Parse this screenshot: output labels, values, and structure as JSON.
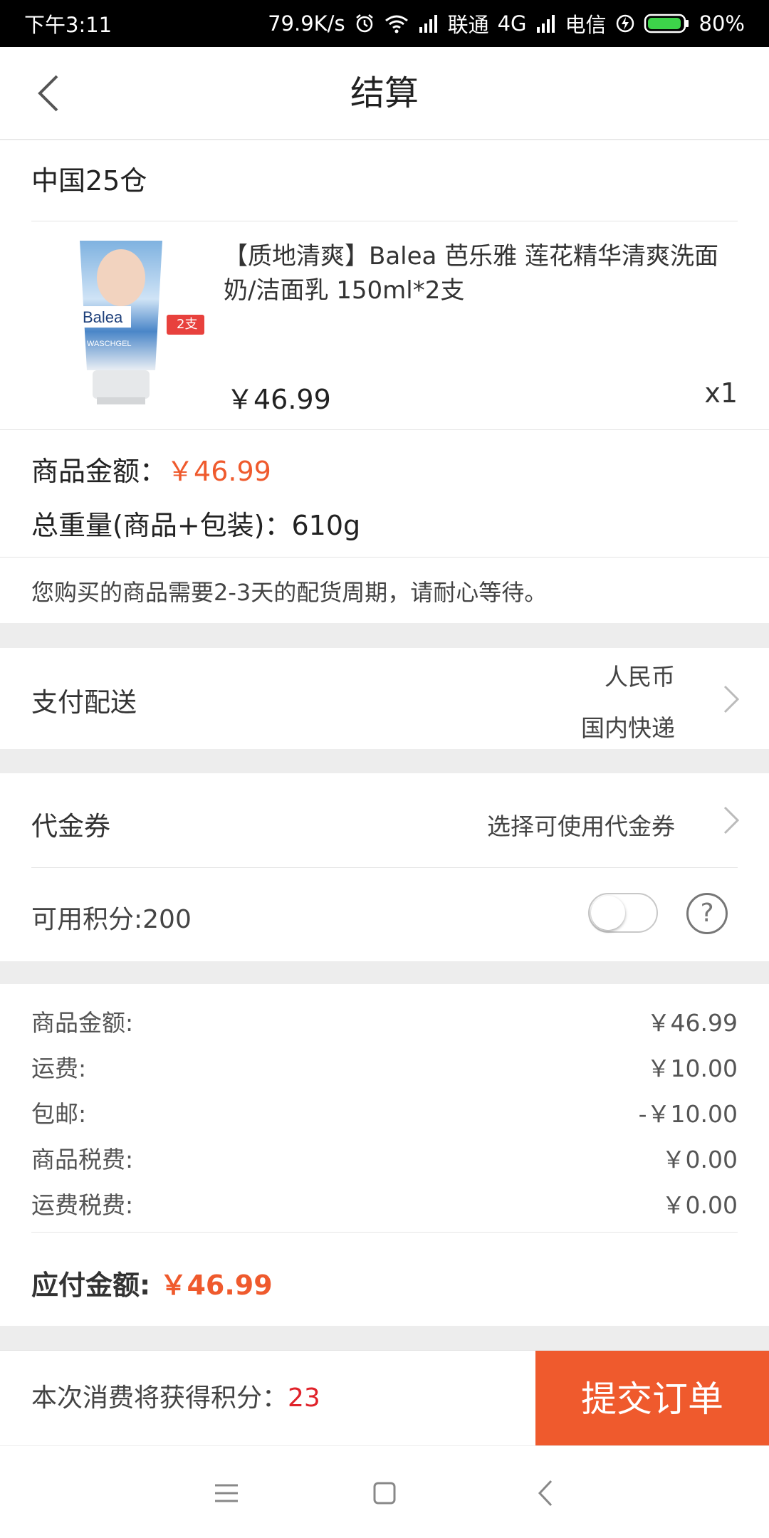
{
  "status_bar": {
    "time": "下午3:11",
    "speed": "79.9K/s",
    "carrier1": "联通",
    "network": "4G",
    "carrier2": "电信",
    "battery": "80%"
  },
  "header": {
    "title": "结算"
  },
  "order": {
    "warehouse": "中国25仓",
    "product": {
      "title": "【质地清爽】Balea 芭乐雅 莲花精华清爽洗面奶/洁面乳 150ml*2支",
      "tag": "2支",
      "image_brand": "Balea",
      "image_sub": "WASCHGEL",
      "price": "￥46.99",
      "qty": "x1"
    },
    "goods_amount_label": "商品金额：",
    "goods_amount_value": "￥46.99",
    "weight_text": "总重量(商品+包装)：610g",
    "notice": "您购买的商品需要2-3天的配货周期，请耐心等待。"
  },
  "payment": {
    "label": "支付配送",
    "currency": "人民币",
    "shipping": "国内快递"
  },
  "voucher": {
    "label": "代金券",
    "action": "选择可使用代金券"
  },
  "points": {
    "label": "可用积分:200",
    "help": "?",
    "toggle_on": false
  },
  "fees": [
    {
      "label": "商品金额:",
      "value": "￥46.99"
    },
    {
      "label": "运费:",
      "value": "￥10.00"
    },
    {
      "label": "包邮:",
      "value": "-￥10.00"
    },
    {
      "label": "商品税费:",
      "value": "￥0.00"
    },
    {
      "label": "运费税费:",
      "value": "￥0.00"
    }
  ],
  "payable": {
    "label": "应付金额: ",
    "value": "￥46.99"
  },
  "footer": {
    "earn_label": "本次消费将获得积分：",
    "earn_points": "23",
    "submit": "提交订单"
  },
  "icons": {
    "back": "back-arrow-icon",
    "chevron": "chevron-right-icon",
    "menu": "menu-icon",
    "home": "home-icon",
    "sys_back": "back-icon"
  },
  "colors": {
    "accent": "#ef5a2d",
    "earn_points": "#e0222a",
    "tag": "#e8413d"
  }
}
